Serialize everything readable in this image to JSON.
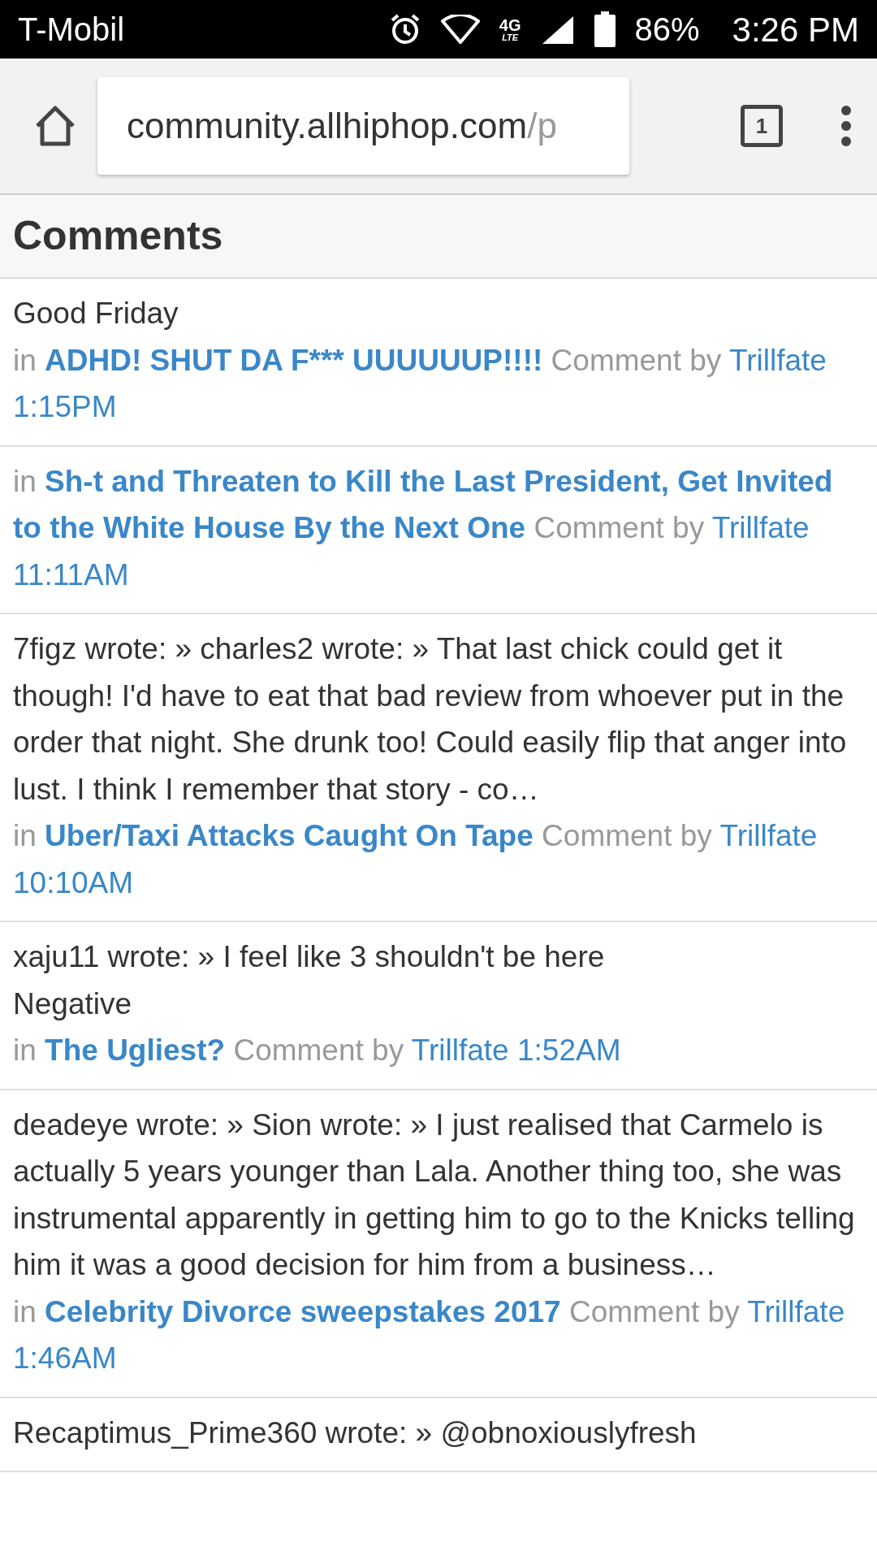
{
  "status_bar": {
    "carrier": "T-Mobil",
    "network": "4G",
    "network_sub": "LTE",
    "battery": "86%",
    "time": "3:26 PM"
  },
  "browser": {
    "url_host": "community.allhiphop.com",
    "url_path": "/p",
    "tab_count": "1"
  },
  "section_title": "Comments",
  "comments": [
    {
      "body": "Good Friday",
      "meta": {
        "in": "in",
        "thread": "ADHD! SHUT DA F*** UUUUUUP!!!!",
        "by": "Comment by",
        "author": "Trillfate",
        "time": "1:15PM"
      }
    },
    {
      "meta": {
        "in": "in",
        "thread": "Sh-t and Threaten to Kill the Last President, Get Invited to the White House By the Next One",
        "by": "Comment by",
        "author": "Trillfate",
        "time": "11:11AM"
      }
    },
    {
      "body": "7figz wrote: » charles2 wrote: » That last chick could get it though! I'd have to eat that bad review from whoever put in the order that night. She drunk too! Could easily flip that anger into lust. I think I remember that story - co…",
      "meta": {
        "in": "in",
        "thread": "Uber/Taxi Attacks Caught On Tape",
        "by": "Comment by",
        "author": "Trillfate",
        "time": "10:10AM"
      }
    },
    {
      "body": "xaju11 wrote: » I feel like 3 shouldn't be here\nNegative",
      "meta": {
        "in": "in",
        "thread": "The Ugliest?",
        "by": "Comment by",
        "author": "Trillfate",
        "time": "1:52AM"
      }
    },
    {
      "body": "deadeye wrote: » Sion wrote: » I just realised that Carmelo is actually 5 years younger than Lala. Another thing too, she was instrumental apparently in getting him to go to the Knicks telling him it was a good decision for him from a business…",
      "meta": {
        "in": "in",
        "thread": "Celebrity Divorce sweepstakes 2017",
        "by": "Comment by",
        "author": "Trillfate",
        "time": "1:46AM"
      }
    },
    {
      "body": "Recaptimus_Prime360 wrote: » @obnoxiouslyfresh"
    }
  ]
}
